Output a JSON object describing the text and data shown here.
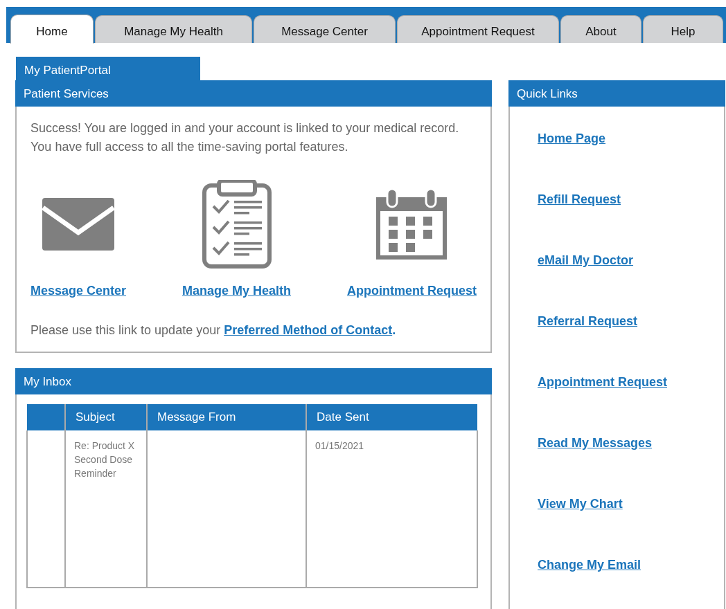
{
  "tabs": [
    {
      "label": "Home",
      "selected": true
    },
    {
      "label": "Manage My Health",
      "selected": false
    },
    {
      "label": "Message Center",
      "selected": false
    },
    {
      "label": "Appointment Request",
      "selected": false
    },
    {
      "label": "About",
      "selected": false
    },
    {
      "label": "Help",
      "selected": false
    }
  ],
  "portal_title": "My PatientPortal",
  "patient_services": {
    "title": "Patient Services",
    "message": "Success! You are logged in and your account is linked to your medical record. You have full access to all the time-saving portal features.",
    "shortcuts": [
      {
        "kind": "envelope",
        "label": "Message Center"
      },
      {
        "kind": "clipboard",
        "label": "Manage My Health"
      },
      {
        "kind": "calendar",
        "label": "Appointment Request"
      }
    ],
    "contact_prompt": "Please use this link to update your",
    "contact_link": "Preferred Method of Contact",
    "contact_suffix": "."
  },
  "inbox": {
    "title": "My Inbox",
    "columns": [
      "Subject",
      "Message From",
      "Date Sent"
    ],
    "rows": [
      {
        "subject": "Re: Product X Second Dose Reminder",
        "from": "",
        "date": "01/15/2021"
      }
    ]
  },
  "quick_links": {
    "title": "Quick Links",
    "items": [
      "Home Page",
      "Refill Request",
      "eMail My Doctor",
      "Referral Request",
      "Appointment Request",
      "Read My Messages",
      "View My Chart",
      "Change My Email"
    ]
  }
}
